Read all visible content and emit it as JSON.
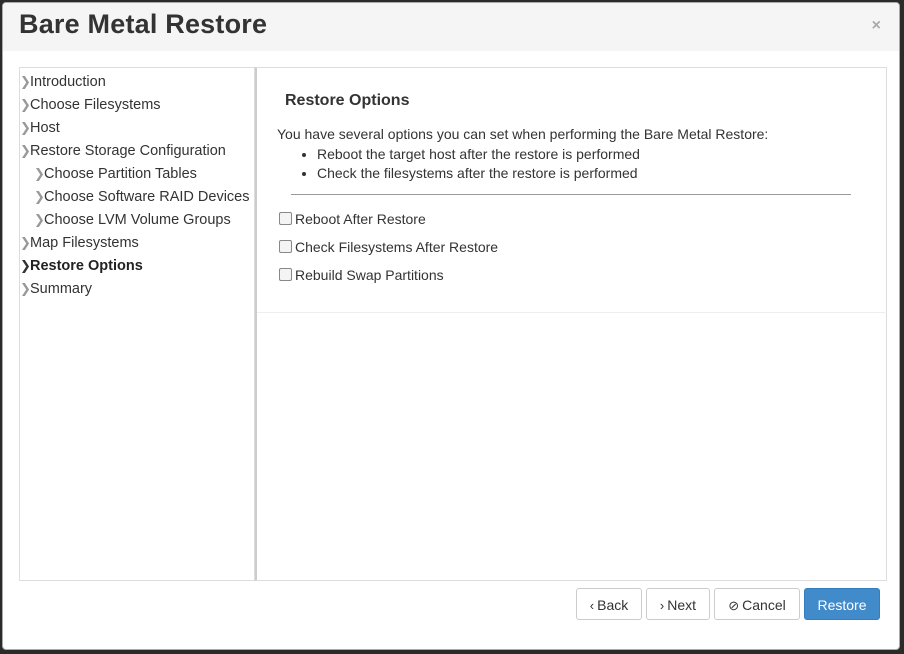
{
  "dialog": {
    "title": "Bare Metal Restore",
    "close_glyph": "×"
  },
  "sidebar": {
    "items": [
      {
        "label": "Introduction",
        "indent": false,
        "active": false
      },
      {
        "label": "Choose Filesystems",
        "indent": false,
        "active": false
      },
      {
        "label": "Host",
        "indent": false,
        "active": false
      },
      {
        "label": "Restore Storage Configuration",
        "indent": false,
        "active": false
      },
      {
        "label": "Choose Partition Tables",
        "indent": true,
        "active": false
      },
      {
        "label": "Choose Software RAID Devices",
        "indent": true,
        "active": false
      },
      {
        "label": "Choose LVM Volume Groups",
        "indent": true,
        "active": false
      },
      {
        "label": "Map Filesystems",
        "indent": false,
        "active": false
      },
      {
        "label": "Restore Options",
        "indent": false,
        "active": true
      },
      {
        "label": "Summary",
        "indent": false,
        "active": false
      }
    ]
  },
  "main": {
    "section_title": "Restore Options",
    "intro": "You have several options you can set when performing the Bare Metal Restore:",
    "bullets": [
      "Reboot the target host after the restore is performed",
      "Check the filesystems after the restore is performed"
    ],
    "options": [
      {
        "label": "Reboot After Restore",
        "checked": false
      },
      {
        "label": "Check Filesystems After Restore",
        "checked": false
      },
      {
        "label": "Rebuild Swap Partitions",
        "checked": false
      }
    ]
  },
  "footer": {
    "back_label": "Back",
    "next_label": "Next",
    "cancel_label": "Cancel",
    "restore_label": "Restore",
    "back_icon": "‹",
    "next_icon": "›",
    "cancel_icon": "⊘"
  },
  "colors": {
    "primary": "#428bca",
    "header_bg": "#f5f5f5"
  }
}
